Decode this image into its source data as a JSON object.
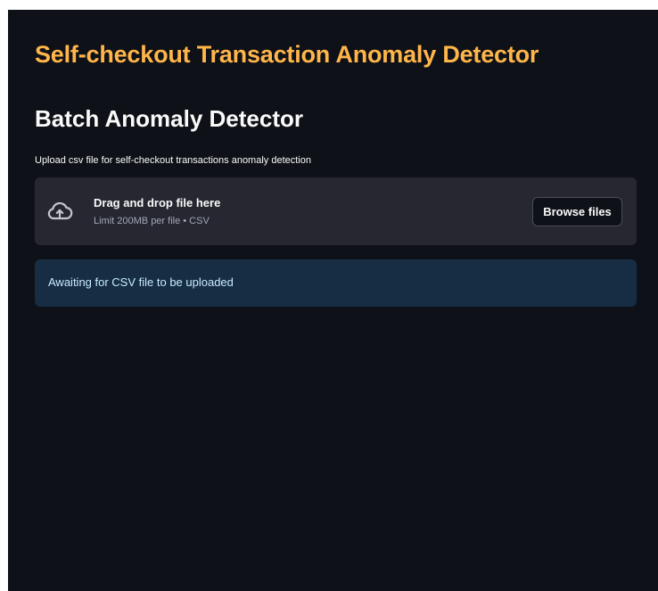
{
  "app": {
    "title": "Self-checkout Transaction Anomaly Detector"
  },
  "section": {
    "title": "Batch Anomaly Detector"
  },
  "uploader": {
    "label": "Upload csv file for self-checkout transactions anomaly detection",
    "drop_title": "Drag and drop file here",
    "drop_subtitle": "Limit 200MB per file • CSV",
    "browse_label": "Browse files",
    "icon": "cloud-upload-icon"
  },
  "alert": {
    "message": "Awaiting for CSV file to be uploaded"
  },
  "colors": {
    "background": "#0e1117",
    "title_accent": "#ffb54a",
    "dropzone_bg": "#262730",
    "info_bg": "#172d43",
    "info_text": "#c7ebff"
  }
}
